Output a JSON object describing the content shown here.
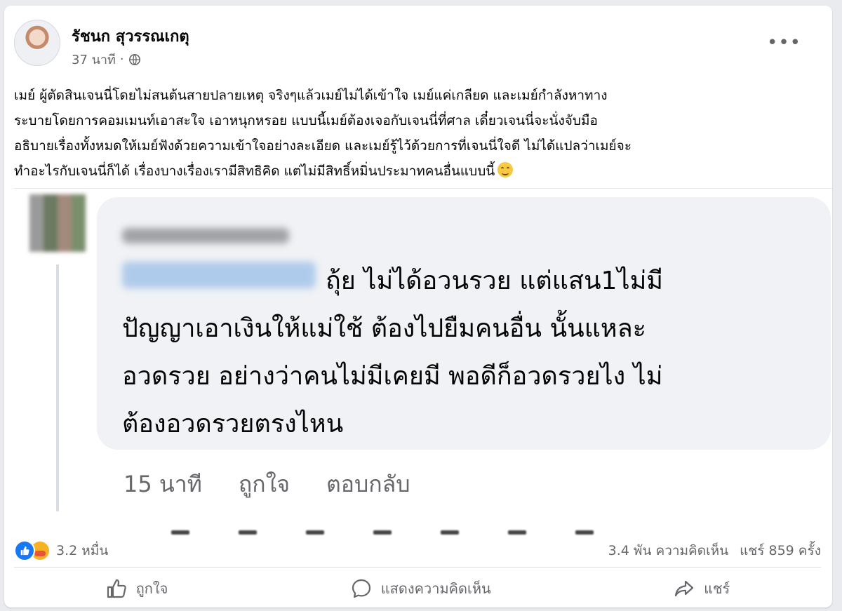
{
  "post": {
    "author": "รัชนก สุวรรณเกตุ",
    "time": "37 นาที",
    "separator": "·",
    "menu": "•••",
    "text_lines": [
      "เมย์ ผู้ตัดสินเจนนี่โดยไม่สนต้นสายปลายเหตุ จริงๆแล้วเมย์ไม่ได้เข้าใจ เมย์แค่เกลียด และเมย์กำลังหาทาง",
      "ระบายโดยการคอมเมนท์เอาสะใจ เอาหนุกหรอย แบบนี้เมย์ต้องเจอกับเจนนี่ที่ศาล เดี๋ยวเจนนี่จะนั่งจับมือ",
      "อธิบายเรื่องทั้งหมดให้เมย์ฟังด้วยความเข้าใจอย่างละเอียด และเมย์รู้ไว้ด้วยการที่เจนนี่ใจดี ไม่ได้แปลว่าเมย์จะ",
      "ทำอะไรกับเจนนี่ก็ได้ เรื่องบางเรื่องเรามีสิทธิคิด แต่ไม่มีสิทธิ์หมิ่นประมาทคนอื่นแบบนี้"
    ],
    "emoji": "smiling-face-emoji"
  },
  "comment": {
    "text_lines": [
      "ถุ้ย ไม่ได้อวนรวย แต่แสน1ไม่มี",
      "ปัญญาเอาเงินให้แม่ใช้ ต้องไปยืมคนอื่น นั้นแหละ",
      "อวดรวย อย่างว่าคนไม่มีเคยมี พอดีก็อวดรวยไง ไม่",
      "ต้องอวดรวยตรงไหน"
    ],
    "time": "15 นาที",
    "like": "ถูกใจ",
    "reply": "ตอบกลับ"
  },
  "stats": {
    "reactions_count": "3.2 หมื่น",
    "comments": "3.4 พัน ความคิดเห็น",
    "shares": "แชร์ 859 ครั้ง"
  },
  "actions": {
    "like": "ถูกใจ",
    "comment": "แสดงความคิดเห็น",
    "share": "แชร์"
  },
  "colors": {
    "like_blue": "#1877f2",
    "secondary_text": "#65676b",
    "bubble_bg": "#f0f2f5"
  }
}
